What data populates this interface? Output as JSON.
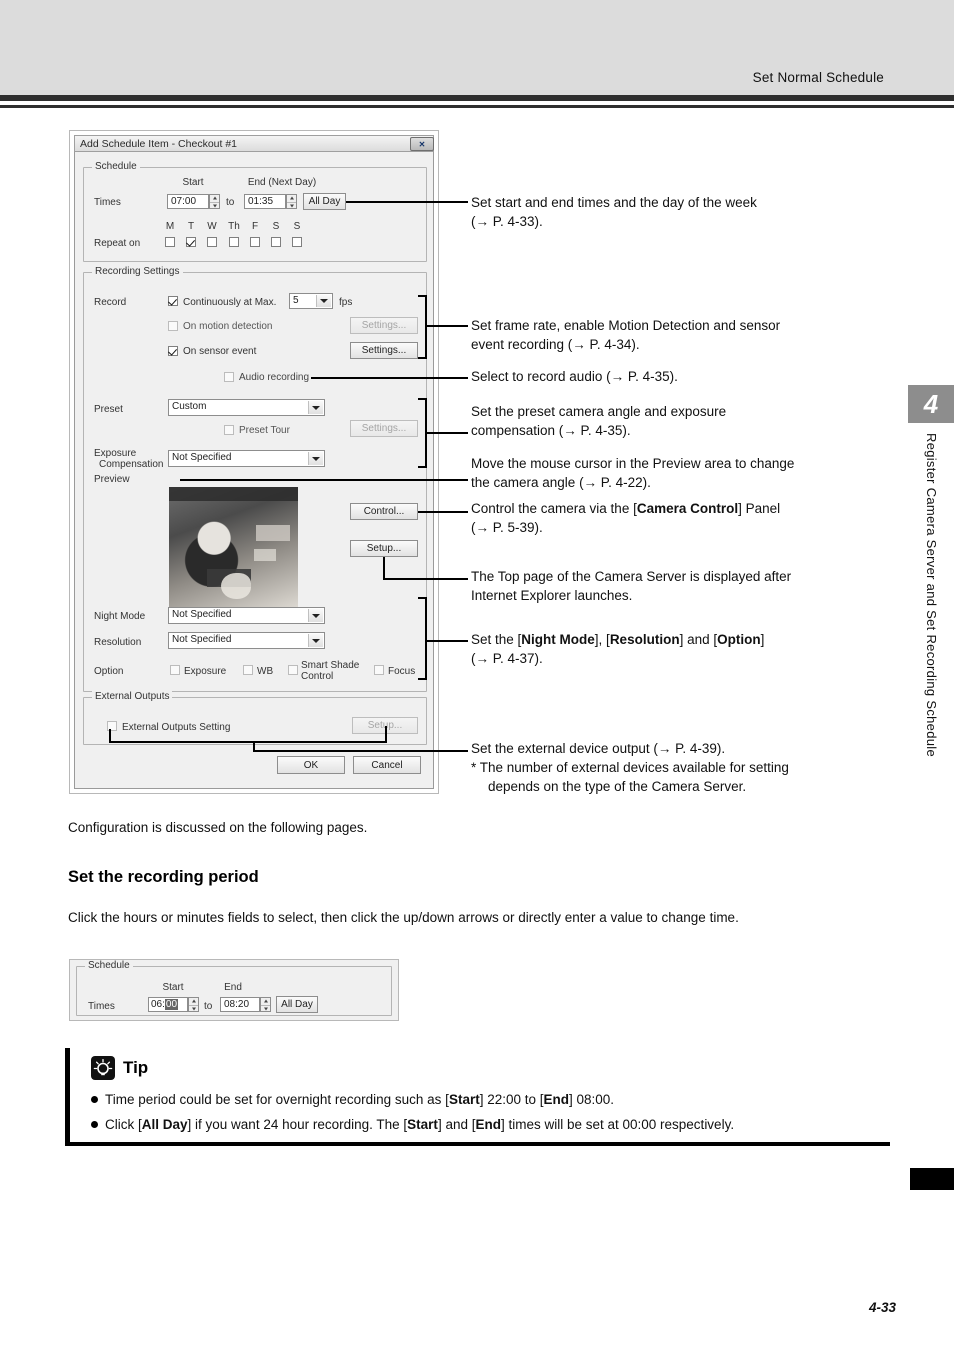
{
  "header": {
    "running_title": "Set Normal Schedule"
  },
  "side_tab": {
    "chapter_number": "4",
    "chapter_title": "Register Camera Server and Set Recording Schedule"
  },
  "footer": {
    "page_number": "4-33"
  },
  "dialog": {
    "title": "Add Schedule Item - Checkout #1",
    "close_label": "✕",
    "schedule_group": {
      "legend": "Schedule",
      "times_label": "Times",
      "start_header": "Start",
      "end_header": "End (Next Day)",
      "start_value": "07:00",
      "to_label": "to",
      "end_value": "01:35",
      "all_day_button": "All Day",
      "repeat_label": "Repeat on",
      "days": [
        {
          "label": "M",
          "checked": false
        },
        {
          "label": "T",
          "checked": true
        },
        {
          "label": "W",
          "checked": false
        },
        {
          "label": "Th",
          "checked": false
        },
        {
          "label": "F",
          "checked": false
        },
        {
          "label": "S",
          "checked": false
        },
        {
          "label": "S",
          "checked": false
        }
      ]
    },
    "recording_group": {
      "legend": "Recording Settings",
      "record_label": "Record",
      "continuously_label": "Continuously at Max.",
      "fps_value": "5",
      "fps_label": "fps",
      "motion_label": "On motion detection",
      "motion_settings_button": "Settings...",
      "sensor_label": "On sensor event",
      "sensor_settings_button": "Settings...",
      "audio_label": "Audio recording",
      "preset_label": "Preset",
      "preset_value": "Custom",
      "preset_tour_label": "Preset Tour",
      "preset_tour_settings_button": "Settings...",
      "exposure_label_line1": "Exposure",
      "exposure_label_line2": "Compensation",
      "exposure_value": "Not Specified",
      "preview_label": "Preview",
      "control_button": "Control...",
      "setup_button": "Setup...",
      "night_mode_label": "Night Mode",
      "night_mode_value": "Not Specified",
      "resolution_label": "Resolution",
      "resolution_value": "Not Specified",
      "option_label": "Option",
      "option_exposure": "Exposure",
      "option_wb": "WB",
      "option_smart_shade_line1": "Smart Shade",
      "option_smart_shade_line2": "Control",
      "option_focus": "Focus"
    },
    "external_group": {
      "legend": "External Outputs",
      "setting_label": "External Outputs Setting",
      "setup_button": "Setup..."
    },
    "ok_button": "OK",
    "cancel_button": "Cancel"
  },
  "annotations": [
    {
      "line1": "Set start and end times and the day of the week",
      "line2": "(→ P. 4-33)."
    },
    {
      "line1": "Set frame rate, enable Motion Detection and sensor",
      "line2": "event recording (→ P. 4-34)."
    },
    {
      "line1": "Select to record audio (→ P. 4-35).",
      "line2": ""
    },
    {
      "line1": "Set the preset camera angle and exposure",
      "line2": "compensation (→ P. 4-35)."
    },
    {
      "line1": "Move the mouse cursor in the Preview area to change",
      "line2": "the camera angle (→ P. 4-22)."
    },
    {
      "line1_pre": "Control the camera via the [",
      "line1_bold": "Camera Control",
      "line1_post": "] Panel",
      "line2": "(→ P. 5-39)."
    },
    {
      "line1": "The Top page of the Camera Server is displayed after",
      "line2": "Internet Explorer launches."
    },
    {
      "line1_pre": "Set the [",
      "line1_bold1": "Night Mode",
      "line1_mid1": "], [",
      "line1_bold2": "Resolution",
      "line1_mid2": "] and [",
      "line1_bold3": "Option",
      "line1_post": "]",
      "line2": "(→ P. 4-37)."
    },
    {
      "line1": "Set the external device output (→ P. 4-39).",
      "line2": "*  The number of external devices available for setting",
      "line3": "depends on the type of the Camera Server."
    }
  ],
  "body": {
    "intro_text": "Configuration is discussed on the following pages.",
    "section_heading": "Set the recording period",
    "section_text": "Click the hours or minutes fields to select, then click the up/down arrows or directly enter a value to change time."
  },
  "schedule_example": {
    "legend": "Schedule",
    "times_label": "Times",
    "start_header": "Start",
    "end_header": "End",
    "start_hours": "06:",
    "start_minutes": "00",
    "to_label": "to",
    "end_value": "08:20",
    "all_day_button": "All Day"
  },
  "tip": {
    "heading": "Tip",
    "icon": "lightbulb-icon",
    "items": [
      {
        "pre": "Time period could be set for overnight recording such as [",
        "b1": "Start",
        "mid1": "] 22:00 to [",
        "b2": "End",
        "post": "] 08:00."
      },
      {
        "pre": "Click [",
        "b1": "All Day",
        "mid1": "] if you want 24 hour recording. The [",
        "b2": "Start",
        "mid2": "] and [",
        "b3": "End",
        "post": "] times will be set at 00:00 respectively."
      }
    ]
  }
}
